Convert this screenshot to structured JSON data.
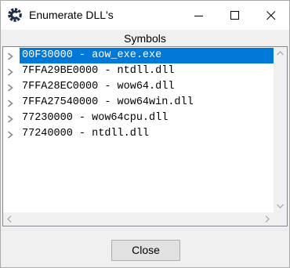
{
  "window": {
    "title": "Enumerate DLL's",
    "icon": "cheat-engine-icon"
  },
  "header": {
    "label": "Symbols"
  },
  "symbols": {
    "items": [
      {
        "text": "00F30000 - aow_exe.exe",
        "selected": true
      },
      {
        "text": "7FFA29BE0000 - ntdll.dll",
        "selected": false
      },
      {
        "text": "7FFA28EC0000 - wow64.dll",
        "selected": false
      },
      {
        "text": "7FFA27540000 - wow64win.dll",
        "selected": false
      },
      {
        "text": "77230000 - wow64cpu.dll",
        "selected": false
      },
      {
        "text": "77240000 - ntdll.dll",
        "selected": false
      }
    ]
  },
  "footer": {
    "close_label": "Close"
  },
  "colors": {
    "selection": "#0078d7",
    "chevron": "#8a8a8a",
    "window_bg": "#f0f0f0"
  }
}
